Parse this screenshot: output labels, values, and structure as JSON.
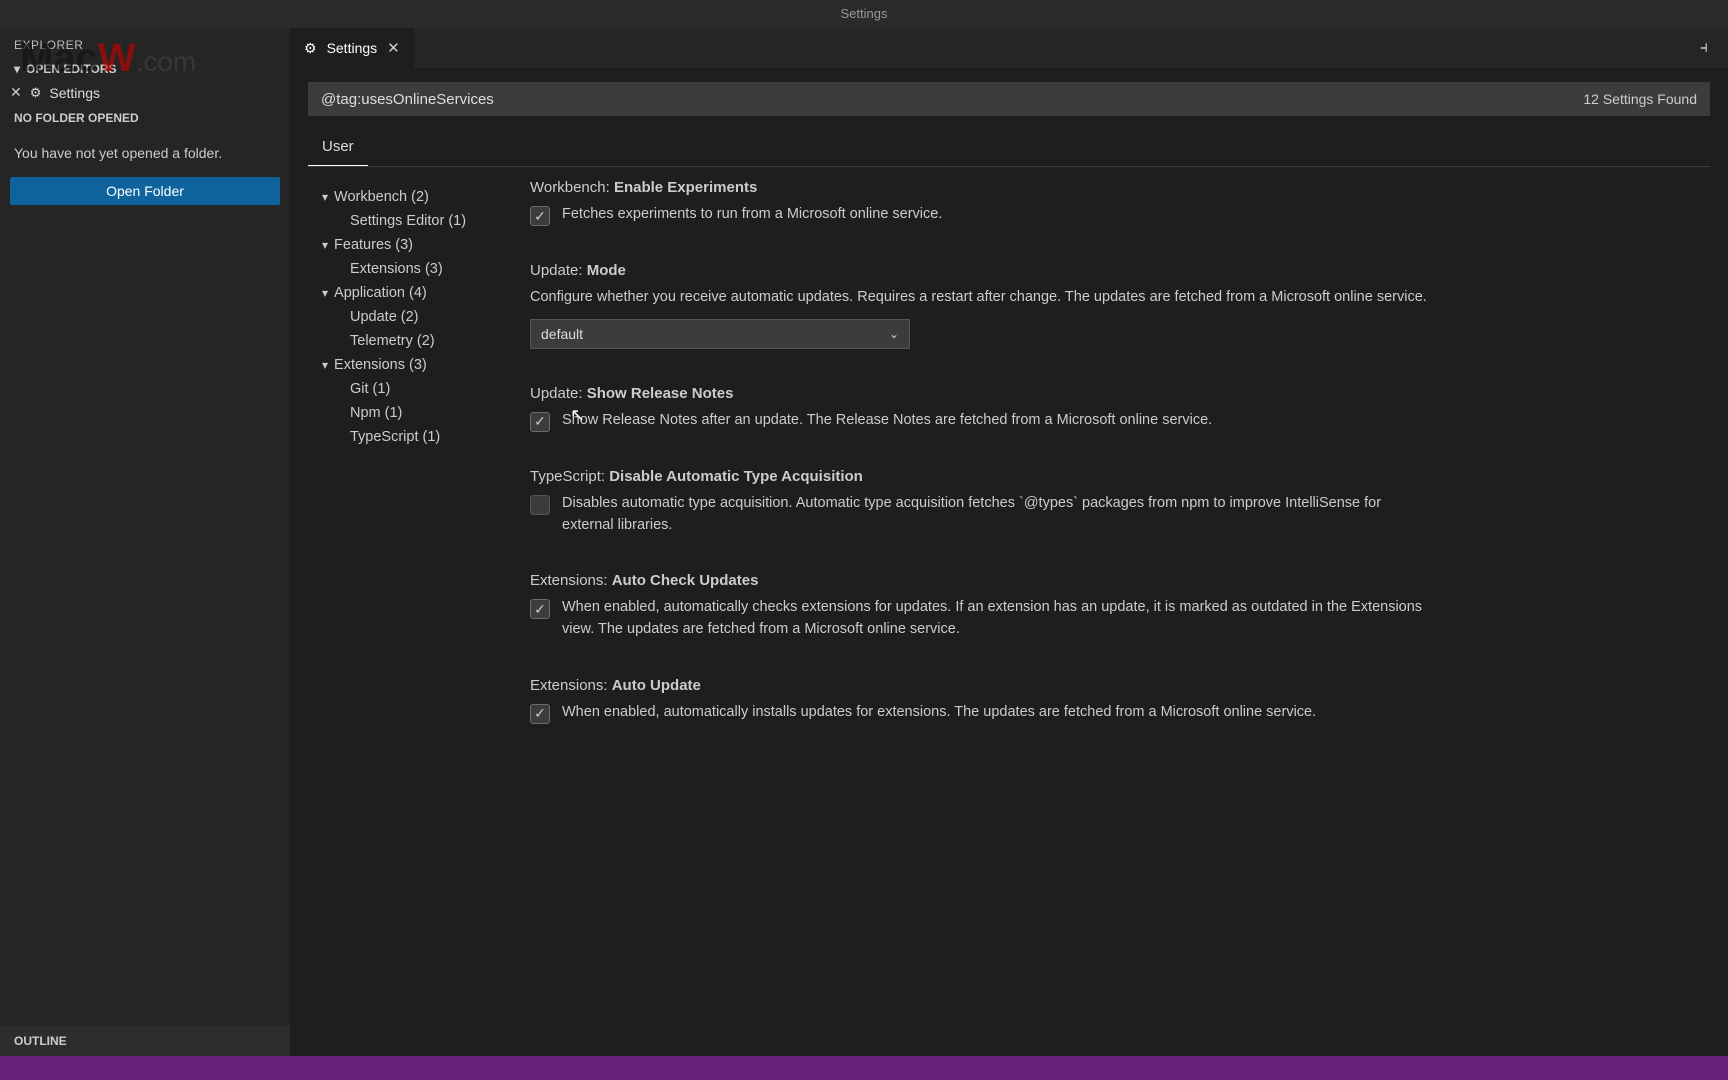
{
  "titlebar": {
    "title": "Settings"
  },
  "sidebar": {
    "explorer_label": "EXPLORER",
    "open_editors_label": "OPEN EDITORS",
    "open_editor_item": "Settings",
    "no_folder_label": "NO FOLDER OPENED",
    "no_folder_message": "You have not yet opened a folder.",
    "open_folder_button": "Open Folder",
    "outline_label": "OUTLINE"
  },
  "tab": {
    "label": "Settings"
  },
  "search": {
    "value": "@tag:usesOnlineServices",
    "found_label": "12 Settings Found"
  },
  "scope": {
    "user": "User"
  },
  "toc": {
    "groups": [
      {
        "label": "Workbench",
        "count": "(2)",
        "children": [
          {
            "label": "Settings Editor",
            "count": "(1)"
          }
        ]
      },
      {
        "label": "Features",
        "count": "(3)",
        "children": [
          {
            "label": "Extensions",
            "count": "(3)"
          }
        ]
      },
      {
        "label": "Application",
        "count": "(4)",
        "children": [
          {
            "label": "Update",
            "count": "(2)"
          },
          {
            "label": "Telemetry",
            "count": "(2)"
          }
        ]
      },
      {
        "label": "Extensions",
        "count": "(3)",
        "children": [
          {
            "label": "Git",
            "count": "(1)"
          },
          {
            "label": "Npm",
            "count": "(1)"
          },
          {
            "label": "TypeScript",
            "count": "(1)"
          }
        ]
      }
    ]
  },
  "settings": [
    {
      "scope": "Workbench:",
      "name": "Enable Experiments",
      "type": "checkbox",
      "checked": true,
      "desc": "Fetches experiments to run from a Microsoft online service."
    },
    {
      "scope": "Update:",
      "name": "Mode",
      "type": "dropdown",
      "desc": "Configure whether you receive automatic updates. Requires a restart after change. The updates are fetched from a Microsoft online service.",
      "value": "default"
    },
    {
      "scope": "Update:",
      "name": "Show Release Notes",
      "type": "checkbox",
      "checked": true,
      "desc": "Show Release Notes after an update. The Release Notes are fetched from a Microsoft online service."
    },
    {
      "scope": "TypeScript:",
      "name": "Disable Automatic Type Acquisition",
      "type": "checkbox",
      "checked": false,
      "desc": "Disables automatic type acquisition. Automatic type acquisition fetches `@types` packages from npm to improve IntelliSense for external libraries."
    },
    {
      "scope": "Extensions:",
      "name": "Auto Check Updates",
      "type": "checkbox",
      "checked": true,
      "desc": "When enabled, automatically checks extensions for updates. If an extension has an update, it is marked as outdated in the Extensions view. The updates are fetched from a Microsoft online service."
    },
    {
      "scope": "Extensions:",
      "name": "Auto Update",
      "type": "checkbox",
      "checked": true,
      "desc": "When enabled, automatically installs updates for extensions. The updates are fetched from a Microsoft online service."
    }
  ],
  "watermark": {
    "text": "MacW",
    "suffix": ".com"
  }
}
